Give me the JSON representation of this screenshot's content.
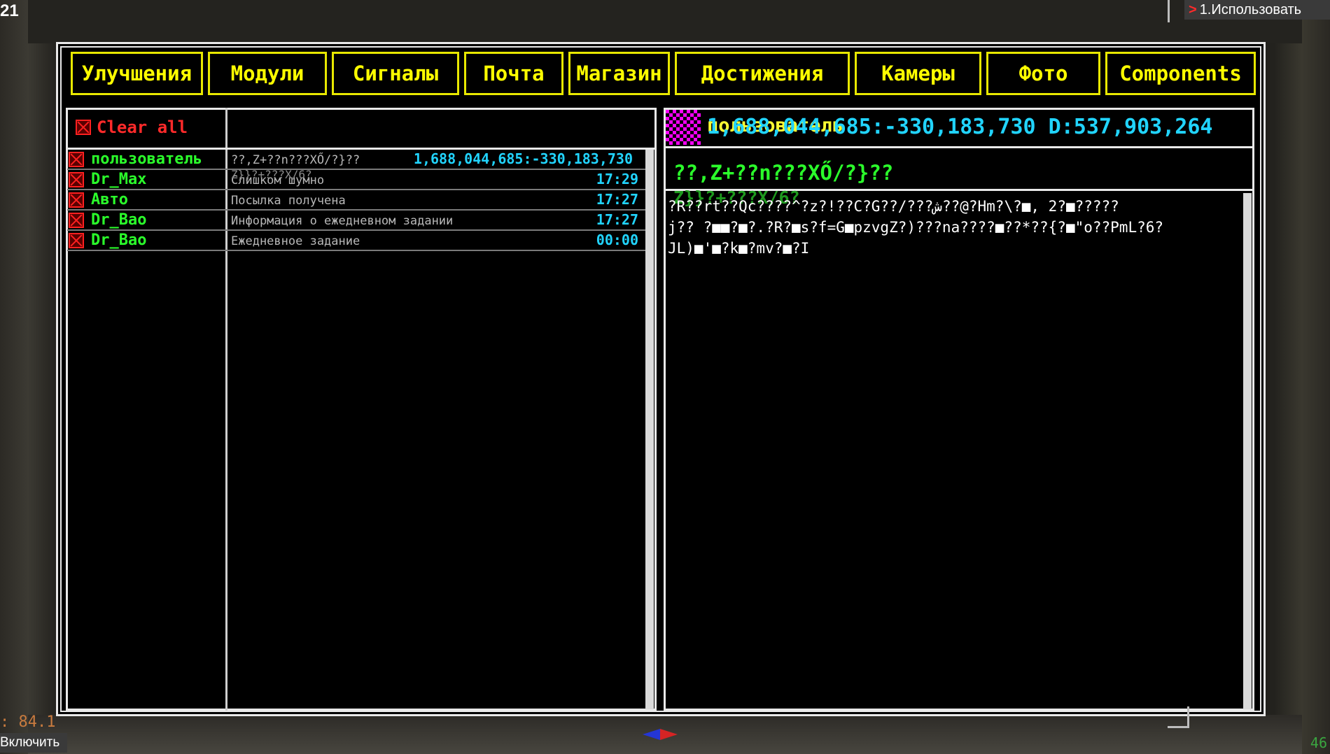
{
  "hud": {
    "top_left": "21",
    "top_right_action": "1.Использовать",
    "bottom_left_value": ": 84.1",
    "bottom_left_action": "Включить",
    "bottom_right": "46"
  },
  "tabs": [
    {
      "label": "Улучшения"
    },
    {
      "label": "Модули"
    },
    {
      "label": "Сигналы"
    },
    {
      "label": "Почта"
    },
    {
      "label": "Магазин"
    },
    {
      "label": "Достижения"
    },
    {
      "label": "Камеры"
    },
    {
      "label": "Фото"
    },
    {
      "label": "Components"
    }
  ],
  "mail": {
    "clear_all_label": "Clear all",
    "messages": [
      {
        "sender": "пользователь",
        "subject": "??,Z+??n???XŐ/?}??",
        "time": "1,688,044,685:-330,183,730"
      },
      {
        "sender": "Dr_Max",
        "subject": "Слишком шумно",
        "time": "17:29"
      },
      {
        "sender": "Авто",
        "subject": "Посылка получена",
        "time": "17:27"
      },
      {
        "sender": "Dr_Bao",
        "subject": "Информация о ежедневном задании",
        "time": "17:27"
      },
      {
        "sender": "Dr_Bao",
        "subject": "Ежедневное задание",
        "time": "00:00"
      }
    ],
    "ghost_text": "Z}}?+???X/6?"
  },
  "detail": {
    "from": "пользователь",
    "coords": "1,688,044,685:-330,183,730 D:537,903,264",
    "subject": "??,Z+??n???XŐ/?}??",
    "subject_ghost": "Z}}?+???X/6?",
    "body_lines": [
      "?R??rt??Qc????^?z?!??C?G??/???ش??@?Hm?\\?■, 2?■?????",
      "j?? ?■■?■?.?R?■s?f=G■pzvgZ?)???na????■??*??{?■\"o??PmL?6?",
      "JL)■'■?k■?mv?■?I"
    ]
  },
  "colors": {
    "tab_yellow": "#ffff00",
    "sender_green": "#2bff2b",
    "time_cyan": "#21d4ff",
    "clear_red": "#ff2a2a",
    "avatar_magenta": "#ff00ff"
  }
}
